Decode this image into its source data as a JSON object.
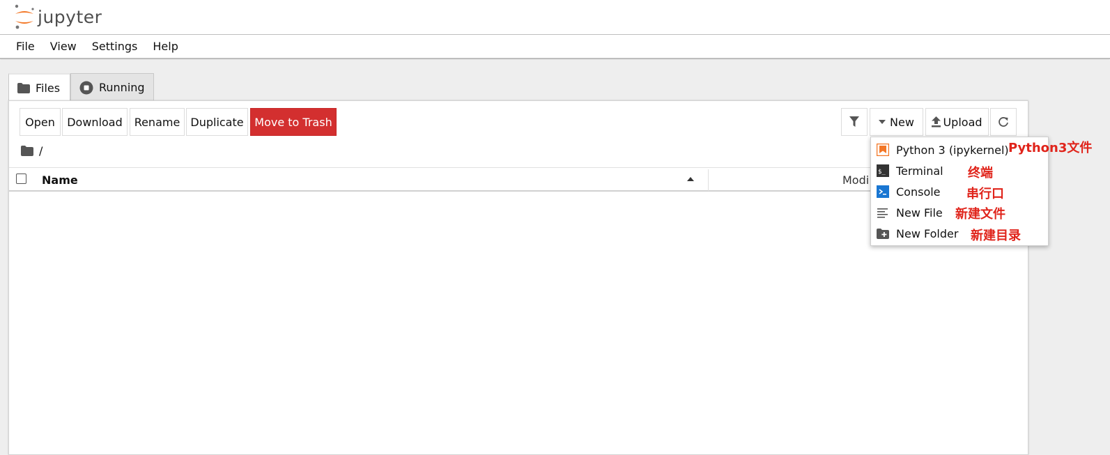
{
  "app": {
    "logo_text": "jupyter"
  },
  "menubar": {
    "items": [
      "File",
      "View",
      "Settings",
      "Help"
    ]
  },
  "tabs": [
    {
      "label": "Files",
      "icon": "folder-icon",
      "active": true
    },
    {
      "label": "Running",
      "icon": "stop-circle-icon",
      "active": false
    }
  ],
  "toolbar": {
    "open": "Open",
    "download": "Download",
    "rename": "Rename",
    "duplicate": "Duplicate",
    "trash": "Move to Trash",
    "new": "New",
    "upload": "Upload",
    "filter_icon": "filter-icon",
    "refresh_icon": "refresh-icon"
  },
  "breadcrumb": {
    "path": "/"
  },
  "table": {
    "columns": [
      "Name",
      "Modi"
    ],
    "sort_indicator": "ascending"
  },
  "new_menu": {
    "items": [
      {
        "label": "Python 3 (ipykernel)",
        "icon": "python-notebook-icon",
        "annotation": "Python3文件"
      },
      {
        "label": "Terminal",
        "icon": "terminal-icon",
        "annotation": "终端"
      },
      {
        "label": "Console",
        "icon": "console-icon",
        "annotation": "串行口"
      },
      {
        "label": "New File",
        "icon": "text-file-icon",
        "annotation": "新建文件"
      },
      {
        "label": "New Folder",
        "icon": "new-folder-icon",
        "annotation": "新建目录"
      }
    ]
  },
  "colors": {
    "accent_orange": "#f37726",
    "trash_red": "#d32f2f",
    "annotation_red": "#e0241b",
    "console_blue": "#1976d2"
  }
}
